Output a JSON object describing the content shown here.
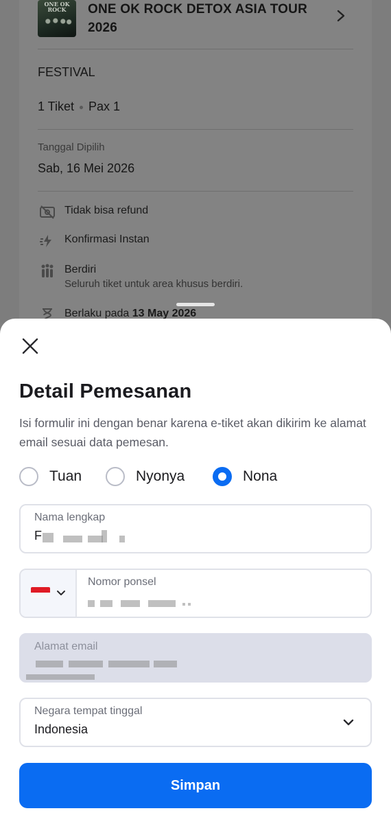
{
  "background_page": {
    "event": {
      "thumbnail_text": "ONE OK ROCK",
      "title": "ONE OK ROCK DETOX ASIA TOUR 2026"
    },
    "ticket_category": "FESTIVAL",
    "quantity": "1 Tiket",
    "pax": "Pax 1",
    "date_label": "Tanggal Dipilih",
    "date_value": "Sab, 16 Mei 2026",
    "features": [
      {
        "icon": "no-refund-icon",
        "title": "Tidak bisa refund"
      },
      {
        "icon": "instant-confirm-icon",
        "title": "Konfirmasi Instan"
      },
      {
        "icon": "standing-people-icon",
        "title": "Berdiri",
        "subtitle": "Seluruh tiket untuk area khusus berdiri."
      },
      {
        "icon": "hourglass-icon",
        "title_prefix": "Berlaku pada",
        "title_bold": "13 May 2026"
      }
    ]
  },
  "sheet": {
    "title": "Detail Pemesanan",
    "description": "Isi formulir ini dengan benar karena e-tiket akan dikirim ke alamat email sesuai data pemesan.",
    "salutations": [
      {
        "label": "Tuan",
        "selected": false
      },
      {
        "label": "Nyonya",
        "selected": false
      },
      {
        "label": "Nona",
        "selected": true
      }
    ],
    "full_name": {
      "label": "Nama lengkap",
      "value_prefix": "F"
    },
    "phone": {
      "label": "Nomor ponsel",
      "country_flag": "Indonesia flag"
    },
    "email": {
      "label": "Alamat email"
    },
    "country": {
      "label": "Negara tempat tinggal",
      "value": "Indonesia"
    },
    "save_label": "Simpan"
  },
  "colors": {
    "accent": "#0a6cf2",
    "overlay": "#7f7f7f",
    "disabled_field": "#dcdee9"
  }
}
